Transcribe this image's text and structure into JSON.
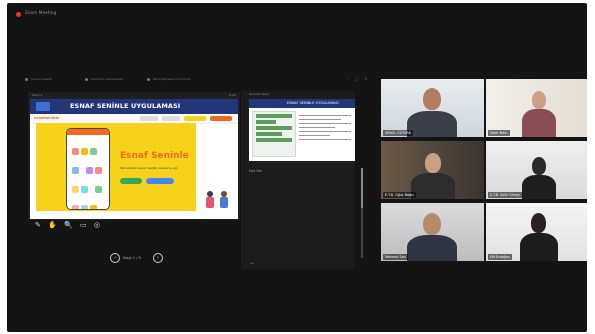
{
  "window": {
    "title": "Zoom Meeting"
  },
  "share_bar": {
    "tabs": [
      "Sunum Göster",
      "Görünüm Seçenekleri",
      "Ekran Paylaşımını Durdur"
    ],
    "controls": [
      "–",
      "▢",
      "✕"
    ]
  },
  "presentation": {
    "top_left": "Slayt 1",
    "top_right": "0:00",
    "slide_title": "ESNAF SENİNLE UYGULAMASI",
    "web_logo": "esnafseninle",
    "hero_title": "Esnaf Seninle",
    "hero_subtitle": "Yakınındaki esnafı keşfet, alışveriş yap",
    "page_label": "Slayt 1 / 9",
    "tools": [
      "✎",
      "✋",
      "🔍",
      "▭",
      "◎"
    ]
  },
  "notes_pane": {
    "header": "Sonraki Slayt",
    "thumb_title": "ESNAF SENİNLE UYGULAMASI",
    "notes_label": "Not Yok",
    "mini_controls": "◂ ▸"
  },
  "participants": [
    {
      "name": "ŞENOL ÖZTÜRK",
      "active": true
    },
    {
      "name": "Sibel Tekin",
      "active": false
    },
    {
      "name": "E.T.B. Oğuz Bağcı",
      "active": false
    },
    {
      "name": "E.T.B. Selin Günay",
      "active": false
    },
    {
      "name": "Mehmet Sarı",
      "active": false
    },
    {
      "name": "Elif Erdoğan",
      "active": false
    }
  ],
  "colors": {
    "background": "#141414",
    "slide_header": "#23367a",
    "brand_orange": "#ef6a1a",
    "brand_yellow": "#f7d21a",
    "active_speaker": "#e4e45a"
  }
}
